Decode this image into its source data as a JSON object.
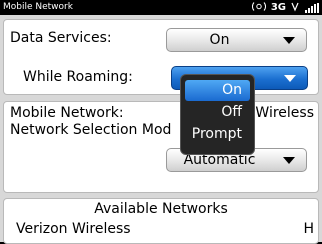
{
  "status_bar": {
    "title": "Mobile Network",
    "network_type": "3G",
    "wifi_icon": "wifi-icon",
    "roaming_icon": "roaming-antenna-icon",
    "signal_icon": "signal-bars-icon"
  },
  "data_services": {
    "label": "Data Services:",
    "value": "On"
  },
  "while_roaming": {
    "label": "While Roaming:",
    "value": "On"
  },
  "roaming_menu": {
    "options": [
      "On",
      "Off",
      "Prompt"
    ],
    "selected": "On"
  },
  "mobile_network": {
    "label": "Mobile Network:",
    "value_visible": "Wireless",
    "selection_label": "Network Selection Mod",
    "selection_value": "Automatic"
  },
  "available_networks": {
    "header": "Available Networks",
    "items": [
      {
        "name": "Verizon Wireless",
        "tech": "H"
      }
    ]
  },
  "colors": {
    "accent": "#1b6fd0",
    "panel": "#d8d8d8",
    "popup": "#252525"
  }
}
